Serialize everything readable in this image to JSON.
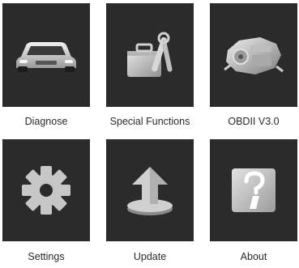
{
  "menu": {
    "items": [
      {
        "label": "Diagnose",
        "icon": "car-icon"
      },
      {
        "label": "Special Functions",
        "icon": "toolbox-icon"
      },
      {
        "label": "OBDII V3.0",
        "icon": "engine-icon"
      },
      {
        "label": "Settings",
        "icon": "gear-icon"
      },
      {
        "label": "Update",
        "icon": "upload-arrow-icon"
      },
      {
        "label": "About",
        "icon": "info-icon"
      }
    ]
  },
  "colors": {
    "tile_bg": "#2b2b2b",
    "icon_silver": "#c9c9c9",
    "label_text": "#2a2a2a"
  }
}
